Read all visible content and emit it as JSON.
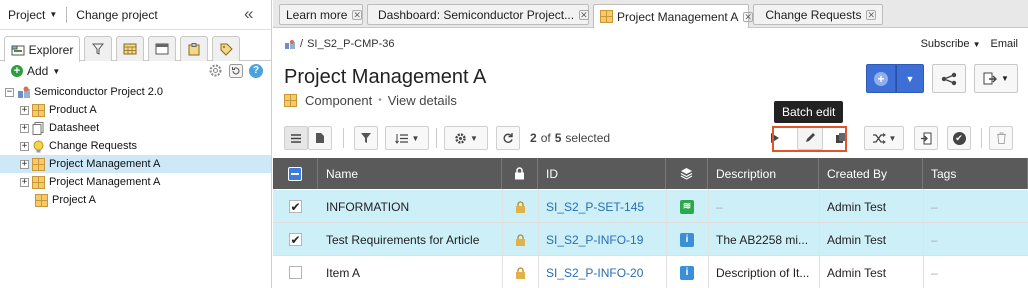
{
  "left": {
    "project_menu": "Project",
    "change_project": "Change project",
    "tabs": {
      "explorer": "Explorer"
    },
    "add_label": "Add",
    "tree": [
      {
        "label": "Semiconductor Project 2.0"
      },
      {
        "label": "Product A"
      },
      {
        "label": "Datasheet"
      },
      {
        "label": "Change Requests"
      },
      {
        "label": "Project Management A"
      },
      {
        "label": "Project Management A"
      },
      {
        "label": "Project A"
      }
    ]
  },
  "tabs": [
    {
      "label": "Learn more"
    },
    {
      "label": "Dashboard: Semiconductor Project..."
    },
    {
      "label": "Project Management A"
    },
    {
      "label": "Change Requests"
    }
  ],
  "main": {
    "breadcrumb": "SI_S2_P-CMP-36",
    "subscribe": "Subscribe",
    "email": "Email",
    "title": "Project Management A",
    "type_label": "Component",
    "bullet": "•",
    "view_details": "View details",
    "selection": {
      "count": "2",
      "of": "of",
      "total": "5",
      "suffix": "selected"
    },
    "tooltip": "Batch edit"
  },
  "table": {
    "headers": {
      "name": "Name",
      "id": "ID",
      "description": "Description",
      "created_by": "Created By",
      "tags": "Tags"
    },
    "rows": [
      {
        "checked": "✔",
        "name": "INFORMATION",
        "id": "SI_S2_P-SET-145",
        "description": "–",
        "created_by": "Admin Test",
        "tags": "–"
      },
      {
        "checked": "✔",
        "name": "Test Requirements for Article",
        "id": "SI_S2_P-INFO-19",
        "description": "The AB2258 mi...",
        "created_by": "Admin Test",
        "tags": "–"
      },
      {
        "checked": "",
        "name": "Item A",
        "id": "SI_S2_P-INFO-20",
        "description": "Description of It...",
        "created_by": "Admin Test",
        "tags": "–"
      }
    ]
  },
  "colors": {
    "accent": "#3d6fd6",
    "selected_row": "#cdeff7",
    "tree_selected": "#cde8f6",
    "highlight": "#e0552a"
  }
}
